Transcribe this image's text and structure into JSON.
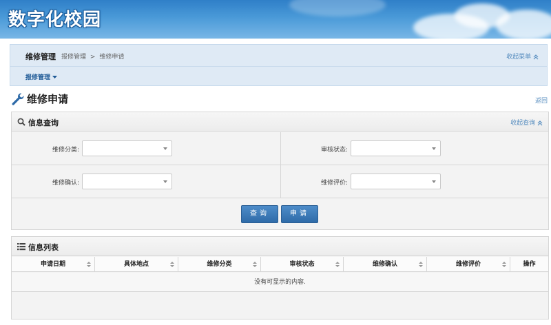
{
  "app": {
    "logo_text": "数字化校园"
  },
  "nav": {
    "title": "维修管理",
    "breadcrumb": [
      "报修管理",
      ">",
      "维修申请"
    ],
    "collapse_label": "收起菜单",
    "submenu_label": "报修管理"
  },
  "page": {
    "title": "维修申请",
    "back_label": "返回"
  },
  "query_panel": {
    "title": "信息查询",
    "collapse_label": "收起查询",
    "fields": [
      {
        "label": "维修分类:",
        "value": ""
      },
      {
        "label": "审核状态:",
        "value": ""
      },
      {
        "label": "维修确认:",
        "value": ""
      },
      {
        "label": "维修评价:",
        "value": ""
      }
    ],
    "buttons": {
      "search": "查询",
      "apply": "申请"
    }
  },
  "list_panel": {
    "title": "信息列表",
    "columns": [
      "申请日期",
      "具体地点",
      "维修分类",
      "审核状态",
      "维修确认",
      "维修评价",
      "操作"
    ],
    "empty_text": "没有可显示的内容."
  },
  "colors": {
    "accent": "#2f6ba8",
    "link": "#5a8fc0",
    "nav_bg": "#dfeaf5"
  }
}
